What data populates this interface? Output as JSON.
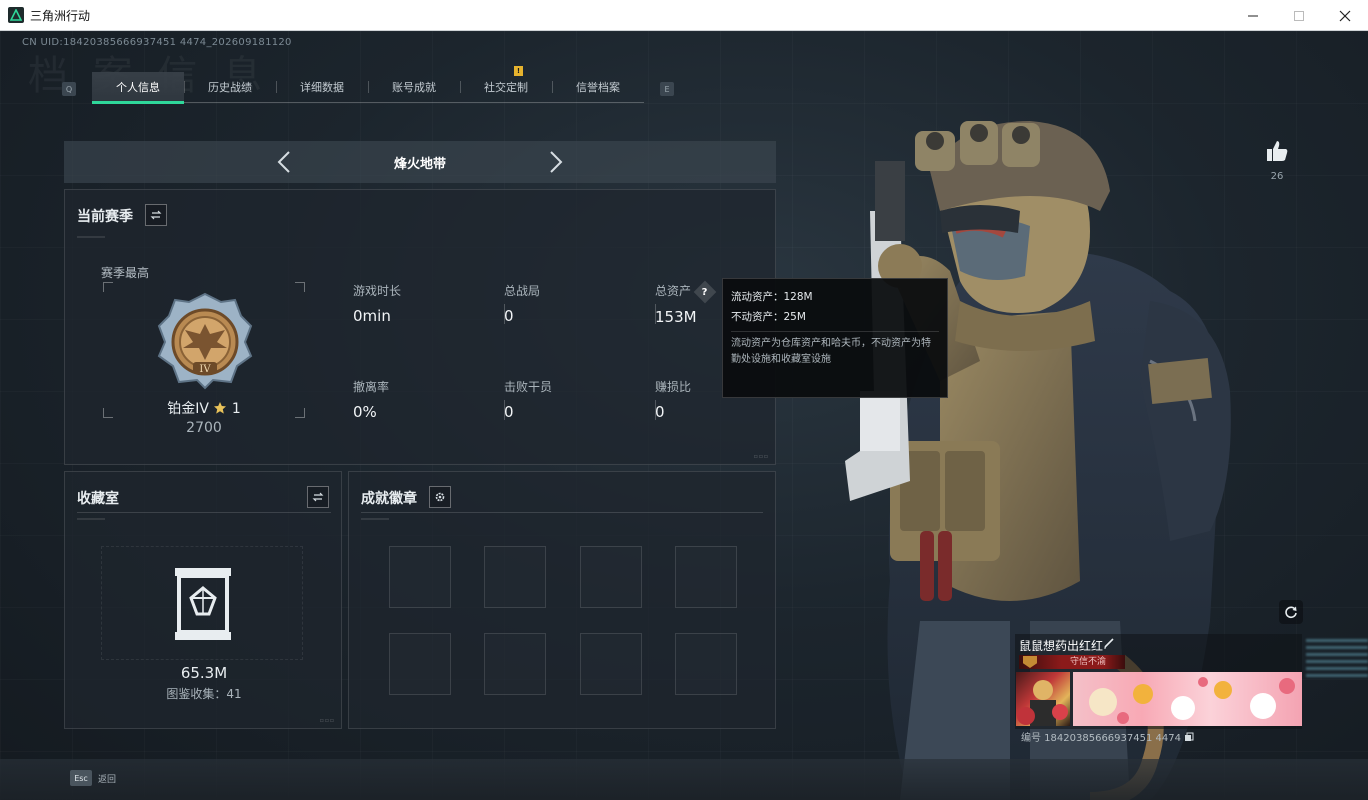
{
  "window": {
    "title": "三角洲行动",
    "controls": [
      "minimize-icon",
      "maximize-icon",
      "close-icon"
    ]
  },
  "header": {
    "uid_line": "CN UID:18420385666937451 4474_202609181120",
    "bg_title": "档 案 信 息",
    "key_left": "Q",
    "key_right": "E"
  },
  "tabs": [
    {
      "label": "个人信息",
      "active": true
    },
    {
      "label": "历史战绩"
    },
    {
      "label": "详细数据"
    },
    {
      "label": "账号成就"
    },
    {
      "label": "社交定制",
      "badge": "!"
    },
    {
      "label": "信誉档案"
    }
  ],
  "mode": {
    "label": "烽火地带"
  },
  "season": {
    "title": "当前赛季",
    "best_label": "赛季最高",
    "rank_name": "铂金IV",
    "rank_stars": "1",
    "rank_points": "2700",
    "medal_numeral": "IV",
    "stats": [
      {
        "label": "游戏时长",
        "value": "0min"
      },
      {
        "label": "总战局",
        "value": "0"
      },
      {
        "label": "总资产",
        "value": "153M",
        "help": true
      },
      {
        "label": "撤离率",
        "value": "0%"
      },
      {
        "label": "击败干员",
        "value": "0"
      },
      {
        "label": "赚损比",
        "value": "0"
      }
    ]
  },
  "tooltip": {
    "liquid": "流动资产：128M",
    "fixed": "不动资产：25M",
    "desc": "流动资产为仓库资产和哈夫币，不动资产为特勤处设施和收藏室设施"
  },
  "collection": {
    "title": "收藏室",
    "value": "65.3M",
    "count_text": "图鉴收集：41"
  },
  "badges": {
    "title": "成就徽章",
    "slots": 8
  },
  "profile": {
    "likes": "26",
    "player_name": "鼠鼠想药出红红",
    "title_badge": "守信不渝",
    "player_uid": "编号 18420385666937451 4474"
  },
  "footer": {
    "esc_key": "Esc",
    "back_label": "返回"
  },
  "colors": {
    "accent": "#2fd79a",
    "tab_badge": "#e6b32e",
    "title_badge": "#8b1a1a"
  }
}
